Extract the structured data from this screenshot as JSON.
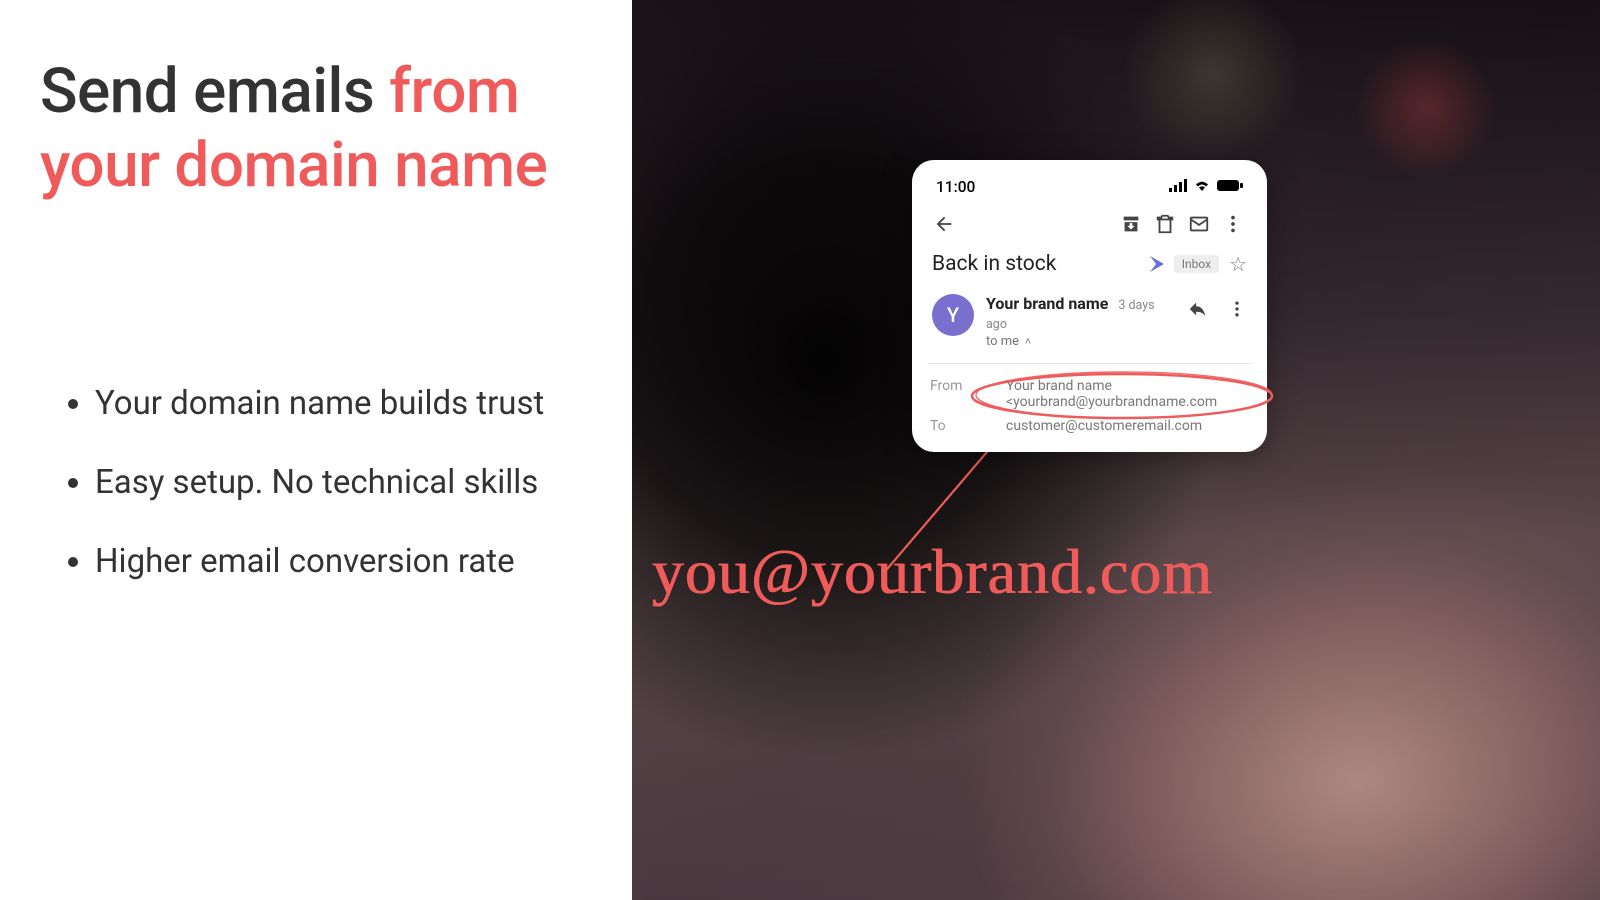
{
  "headline": {
    "part1": "Send emails ",
    "accent": "from your domain name"
  },
  "bullets": [
    "Your domain name builds trust",
    "Easy setup. No technical skills",
    "Higher email conversion rate"
  ],
  "phone": {
    "time": "11:00",
    "subject": "Back in stock",
    "inbox_chip": "Inbox",
    "avatar_letter": "Y",
    "sender_name": "Your brand name",
    "sender_time": "3 days ago",
    "to_me": "to me",
    "from_label": "From",
    "from_value": "Your brand name",
    "from_email": "<yourbrand@yourbrandname.com",
    "to_label": "To",
    "to_value": "customer@customeremail.com"
  },
  "handwritten": "you@yourbrand.com",
  "colors": {
    "accent": "#ef5b5b"
  }
}
